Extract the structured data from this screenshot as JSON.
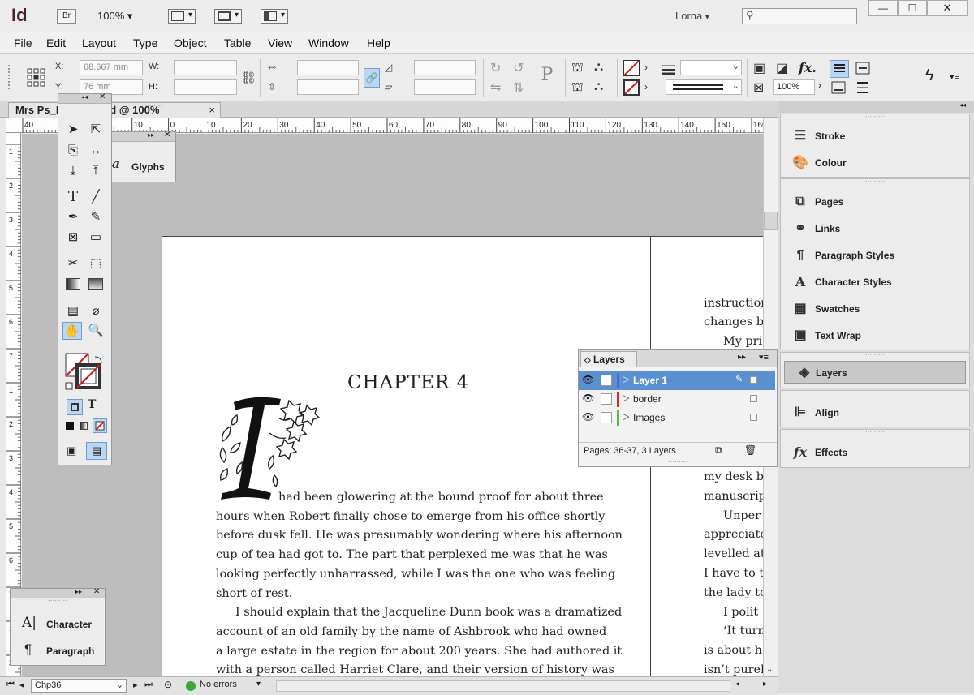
{
  "app": {
    "logo": "Id",
    "bridge_label": "Br",
    "zoom": "100%",
    "user": "Lorna"
  },
  "window_buttons": {
    "minimize": "—",
    "maximize": "☐",
    "close": "✕"
  },
  "menu": [
    "File",
    "Edit",
    "Layout",
    "Type",
    "Object",
    "Table",
    "View",
    "Window",
    "Help"
  ],
  "control": {
    "x_label": "X:",
    "x_value": "68.667 mm",
    "y_label": "Y:",
    "y_value": "76 mm",
    "w_label": "W:",
    "h_label": "H:",
    "scale_value": "100%"
  },
  "document": {
    "tab_title": "Mrs Ps_H…raft.indd @ 100%",
    "close": "×"
  },
  "ruler_labels": [
    "40",
    "30",
    "20",
    "10",
    "0",
    "10",
    "20",
    "30",
    "40",
    "50",
    "60",
    "70",
    "80",
    "90",
    "100",
    "110",
    "120",
    "130",
    "140",
    "150",
    "160"
  ],
  "vruler_labels": [
    "1",
    "2",
    "3",
    "4",
    "5",
    "6",
    "7"
  ],
  "glyphs_panel": {
    "label": "Glyphs"
  },
  "char_panel": {
    "items": [
      "Character",
      "Paragraph"
    ]
  },
  "page": {
    "chapter_heading": "CHAPTER 4",
    "left_lines": [
      "had been glowering at the bound proof for about three",
      "hours when Robert finally chose to emerge from his office shortly",
      "before dusk fell. He was presumably wondering where his afternoon",
      "cup of tea had got to. The part that perplexed me was that he was",
      "looking perfectly unharrassed, while I was the one who was feeling",
      "short of rest.",
      "I should explain that the Jacqueline Dunn book was a dramatized",
      "account of an old family by the name of Ashbrook who had owned",
      "a large estate in the region for about 200 years. She had authored it",
      "with a person called Harriet Clare, and their version of history was"
    ],
    "right_lines_top": [
      "instruction",
      "changes bo",
      "My pri"
    ],
    "right_lines_bottom": [
      "my desk b",
      "manuscrip",
      "Unper",
      "appreciate",
      "levelled at",
      "I have to t",
      "the lady to",
      "I polit",
      "‘It turn",
      "is about h",
      "isn’t purel"
    ]
  },
  "layers_panel": {
    "title": "Layers",
    "layers": [
      {
        "name": "Layer 1",
        "color": "#3f6fd0"
      },
      {
        "name": "border",
        "color": "#d42a2a"
      },
      {
        "name": "Images",
        "color": "#5db847"
      }
    ],
    "footer": "Pages: 36-37, 3 Layers"
  },
  "dock": {
    "group1": [
      "Stroke",
      "Colour"
    ],
    "group2": [
      "Pages",
      "Links",
      "Paragraph Styles",
      "Character Styles",
      "Swatches",
      "Text Wrap"
    ],
    "group3": [
      "Layers"
    ],
    "group4": [
      "Align"
    ],
    "group5": [
      "Effects"
    ]
  },
  "status": {
    "page": "Chp36",
    "errors": "No errors"
  }
}
